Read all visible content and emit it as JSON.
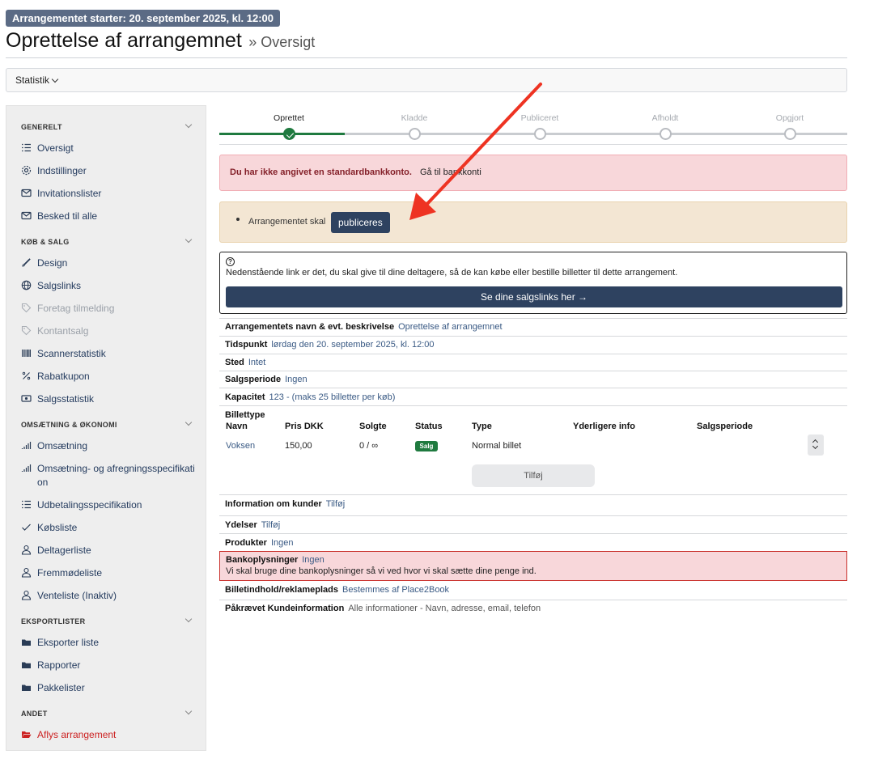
{
  "header": {
    "start_badge": "Arrangementet starter: 20. september 2025, kl. 12:00",
    "title": "Oprettelse af arrangemnet",
    "subtitle": "» Oversigt"
  },
  "toolbar": {
    "statistik_label": "Statistik"
  },
  "sidebar": {
    "sections": [
      {
        "heading": "GENERELT",
        "items": [
          {
            "label": "Oversigt",
            "icon": "list-icon"
          },
          {
            "label": "Indstillinger",
            "icon": "gear-icon"
          },
          {
            "label": "Invitationslister",
            "icon": "envelope-icon"
          },
          {
            "label": "Besked til alle",
            "icon": "envelope-icon"
          }
        ]
      },
      {
        "heading": "KØB & SALG",
        "items": [
          {
            "label": "Design",
            "icon": "brush-icon"
          },
          {
            "label": "Salgslinks",
            "icon": "globe-icon"
          },
          {
            "label": "Foretag tilmelding",
            "icon": "tag-icon",
            "disabled": true
          },
          {
            "label": "Kontantsalg",
            "icon": "tag-icon",
            "disabled": true
          },
          {
            "label": "Scannerstatistik",
            "icon": "barcode-icon"
          },
          {
            "label": "Rabatkupon",
            "icon": "percent-icon"
          },
          {
            "label": "Salgsstatistik",
            "icon": "cash-icon"
          }
        ]
      },
      {
        "heading": "OMSÆTNING & ØKONOMI",
        "items": [
          {
            "label": "Omsætning",
            "icon": "bar-chart-icon"
          },
          {
            "label": "Omsætning- og afregningsspecifikation",
            "icon": "bar-chart-icon"
          },
          {
            "label": "Udbetalingsspecifikation",
            "icon": "list-icon"
          },
          {
            "label": "Købsliste",
            "icon": "check-icon"
          },
          {
            "label": "Deltagerliste",
            "icon": "person-icon"
          },
          {
            "label": "Fremmødeliste",
            "icon": "person-icon"
          },
          {
            "label": "Venteliste (Inaktiv)",
            "icon": "person-icon"
          }
        ]
      },
      {
        "heading": "EKSPORTLISTER",
        "items": [
          {
            "label": "Eksporter liste",
            "icon": "folder-icon"
          },
          {
            "label": "Rapporter",
            "icon": "folder-icon"
          },
          {
            "label": "Pakkelister",
            "icon": "folder-icon"
          }
        ]
      },
      {
        "heading": "ANDET",
        "items": [
          {
            "label": "Aflys arrangement",
            "icon": "folder-open-icon",
            "danger": true
          }
        ]
      }
    ]
  },
  "stepper": {
    "steps": [
      "Oprettet",
      "Kladde",
      "Publiceret",
      "Afholdt",
      "Opgjort"
    ],
    "current_index": 0
  },
  "alerts": {
    "bank_warning": "Du har ikke angivet en standardbankkonto.",
    "bank_link": "Gå til bankkonti",
    "publish_text": "Arrangementet skal",
    "publish_button": "publiceres"
  },
  "info": {
    "text": "Nedenstående link er det, du skal give til dine deltagere, så de kan købe eller bestille billetter til dette arrangement.",
    "button": "Se dine salgslinks her →"
  },
  "details": {
    "name_label": "Arrangementets navn & evt. beskrivelse",
    "name_value": "Oprettelse af arrangemnet",
    "time_label": "Tidspunkt",
    "time_value": "lørdag den 20. september 2025, kl. 12:00",
    "place_label": "Sted",
    "place_value": "Intet",
    "period_label": "Salgsperiode",
    "period_value": "Ingen",
    "capacity_label": "Kapacitet",
    "capacity_value": "123 - (maks 25 billetter per køb)",
    "tickettype_label": "Billettype",
    "customer_info_label": "Information om kunder",
    "customer_info_value": "Tilføj",
    "services_label": "Ydelser",
    "services_value": "Tilføj",
    "products_label": "Produkter",
    "products_value": "Ingen",
    "bank_label": "Bankoplysninger",
    "bank_value": "Ingen",
    "bank_note": "Vi skal bruge dine bankoplysninger så vi ved hvor vi skal sætte dine penge ind.",
    "ticket_content_label": "Billetindhold/reklameplads",
    "ticket_content_value": "Bestemmes af Place2Book",
    "required_info_label": "Påkrævet Kundeinformation",
    "required_info_value": "Alle informationer - Navn, adresse, email, telefon"
  },
  "ticket_table": {
    "columns": [
      "Navn",
      "Pris DKK",
      "Solgte",
      "Status",
      "Type",
      "Yderligere info",
      "Salgsperiode"
    ],
    "rows": [
      {
        "name": "Voksen",
        "price": "150,00",
        "sold": "0 / ∞",
        "status": "Salg",
        "type": "Normal billet",
        "info": "",
        "period": ""
      }
    ],
    "add_button": "Tilføj"
  },
  "colors": {
    "primary": "#2e4260",
    "success": "#1f7a3f",
    "danger": "#cc2222",
    "annotation_arrow": "#ee3322"
  }
}
